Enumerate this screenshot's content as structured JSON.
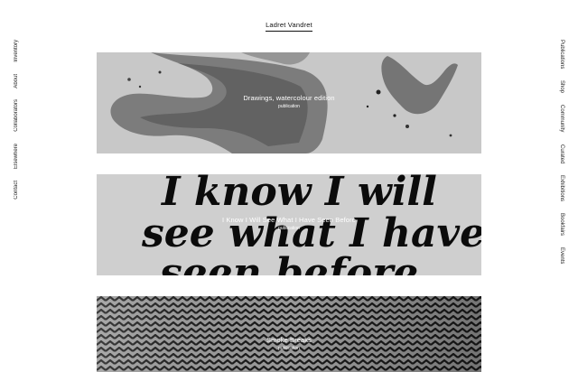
{
  "site": {
    "title": "Ladret Vandret"
  },
  "left_nav": [
    {
      "label": "Inventory"
    },
    {
      "label": "About"
    },
    {
      "label": "Collaborators"
    },
    {
      "label": "Elsewhere"
    },
    {
      "label": "Contact"
    }
  ],
  "right_nav": [
    {
      "label": "Publications"
    },
    {
      "label": "Shop"
    },
    {
      "label": "Community"
    },
    {
      "label": "Curated"
    },
    {
      "label": "Exhibitions"
    },
    {
      "label": "Bookfairs"
    },
    {
      "label": "Events"
    }
  ],
  "cards": [
    {
      "title": "Drawings, watercolour edition",
      "type": "publication"
    },
    {
      "title": "I Know I Will See What I Have Seen Before",
      "type": "publication",
      "artwork_text": [
        "I know I will",
        "see what I have",
        "seen before"
      ]
    },
    {
      "title": "Smoke Breaks",
      "type": "publication"
    }
  ],
  "colors": {
    "text": "#111111",
    "card_gray": "#cfcfcf",
    "ink": "#0b0b0b"
  }
}
